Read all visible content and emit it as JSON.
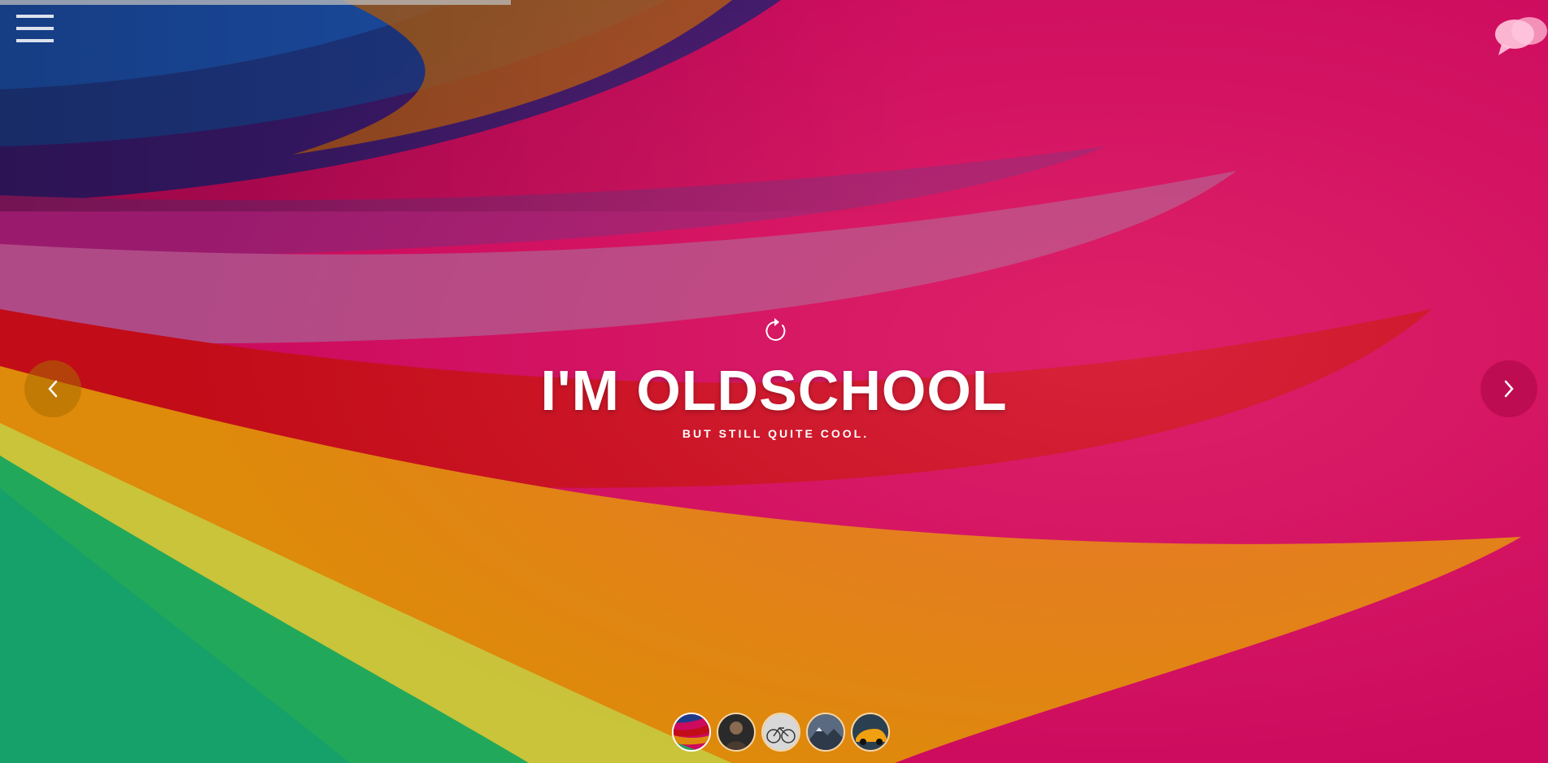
{
  "hero": {
    "title": "I'M OLDSCHOOL",
    "subtitle": "BUT STILL QUITE COOL."
  },
  "slider": {
    "progress": 0.33,
    "active_slide": 1,
    "slide_count": 5,
    "thumbnails": [
      {
        "name": "rainbow-paper",
        "active": true
      },
      {
        "name": "portrait",
        "active": false
      },
      {
        "name": "bicycle",
        "active": false
      },
      {
        "name": "mountain",
        "active": false
      },
      {
        "name": "car",
        "active": false
      }
    ]
  },
  "icons": {
    "menu": "hamburger-menu-icon",
    "chat": "chat-bubbles-icon",
    "reload": "reload-icon",
    "prev": "chevron-left-icon",
    "next": "chevron-right-icon"
  },
  "colors": {
    "background": "#c40a5c",
    "title": "#ffffff"
  }
}
